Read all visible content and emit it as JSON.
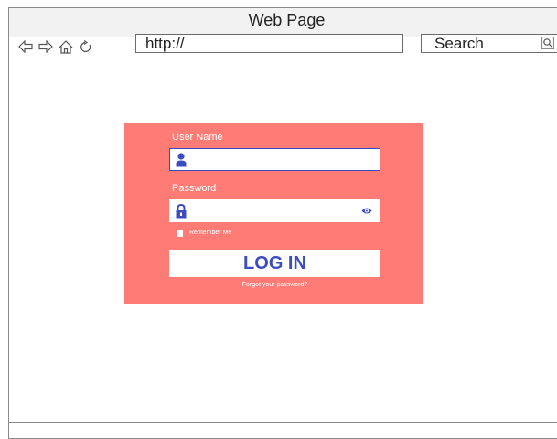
{
  "browser": {
    "title": "Web Page",
    "url": "http://",
    "search_label": "Search",
    "nav_icons": [
      "back-arrow-icon",
      "forward-arrow-icon",
      "home-icon",
      "refresh-icon"
    ]
  },
  "login": {
    "username_label": "User Name",
    "username_value": "",
    "password_label": "Password",
    "password_value": "",
    "remember_label": "Remember Me",
    "remember_checked": false,
    "login_button": "LOG IN",
    "forgot_link": "Forgot your password?"
  },
  "colors": {
    "panel": "#ff7b76",
    "accent": "#3b4cc0",
    "border": "#8a8a8a"
  }
}
